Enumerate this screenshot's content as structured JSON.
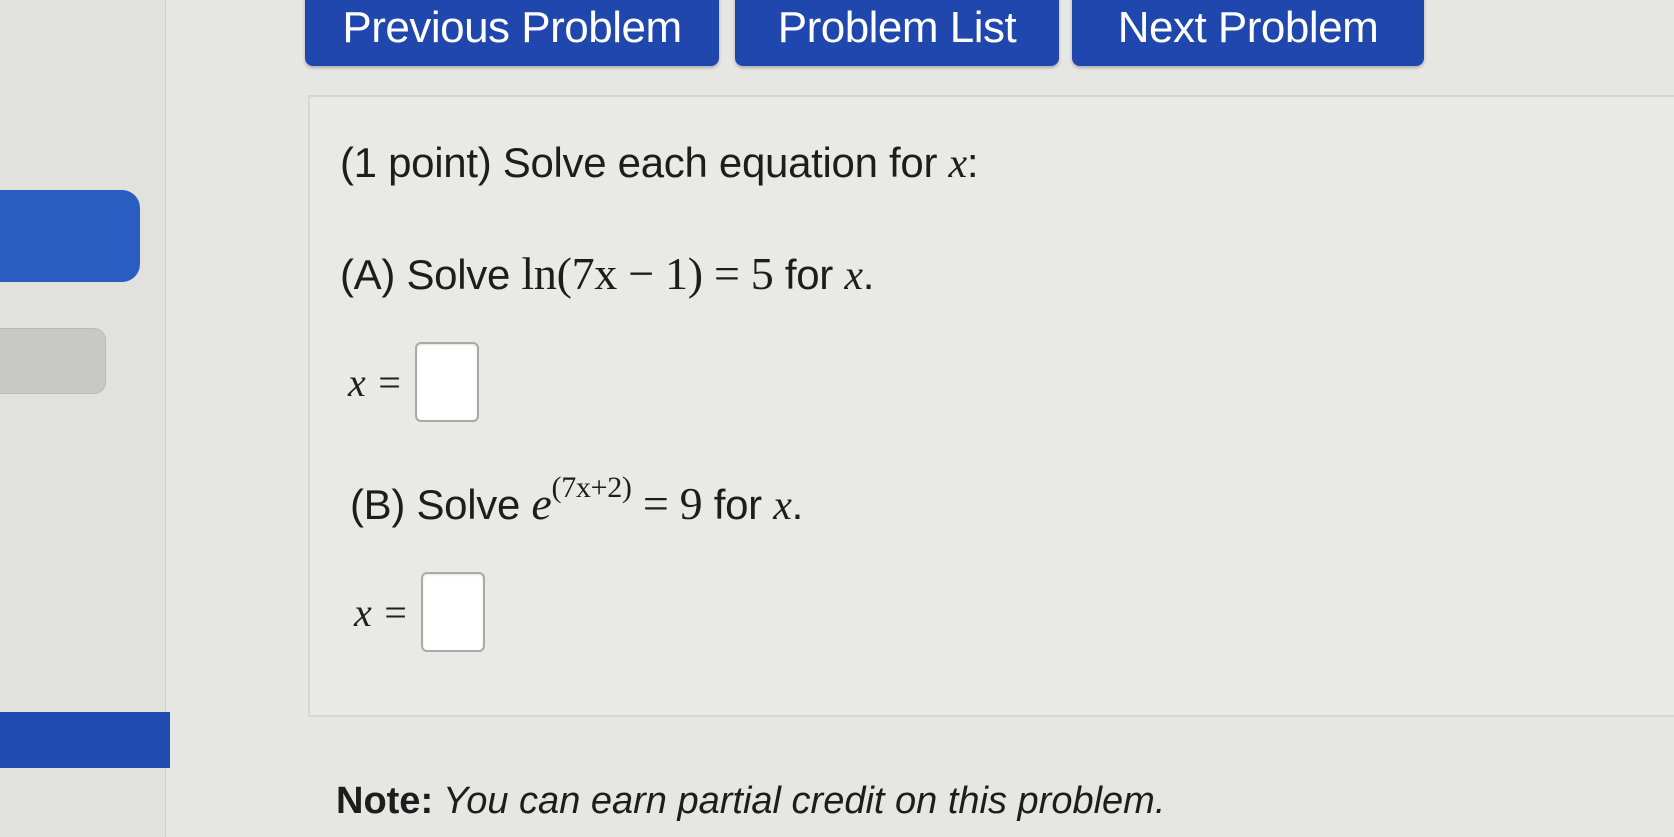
{
  "nav": {
    "previous_label": "Previous Problem",
    "list_label": "Problem List",
    "next_label": "Next Problem"
  },
  "problem": {
    "intro_prefix": "(1 point) Solve each equation for ",
    "intro_var": "x",
    "intro_suffix": ":",
    "part_a": {
      "prefix": "(A) Solve ",
      "equation": "ln(7x − 1) = 5",
      "suffix_word": " for ",
      "suffix_var": "x",
      "suffix_end": ".",
      "answer_label": "x =",
      "answer_value": ""
    },
    "part_b": {
      "prefix": "(B) Solve ",
      "base": "e",
      "exponent": "(7x+2)",
      "rhs": " = 9",
      "suffix_word": " for ",
      "suffix_var": "x",
      "suffix_end": ".",
      "answer_label": "x =",
      "answer_value": ""
    }
  },
  "note": {
    "label": "Note:",
    "text": " You can earn partial credit on this problem."
  },
  "colors": {
    "nav_button": "#1f47ad",
    "sidebar_active": "#2b5cc2",
    "background": "#e6e7e3"
  }
}
